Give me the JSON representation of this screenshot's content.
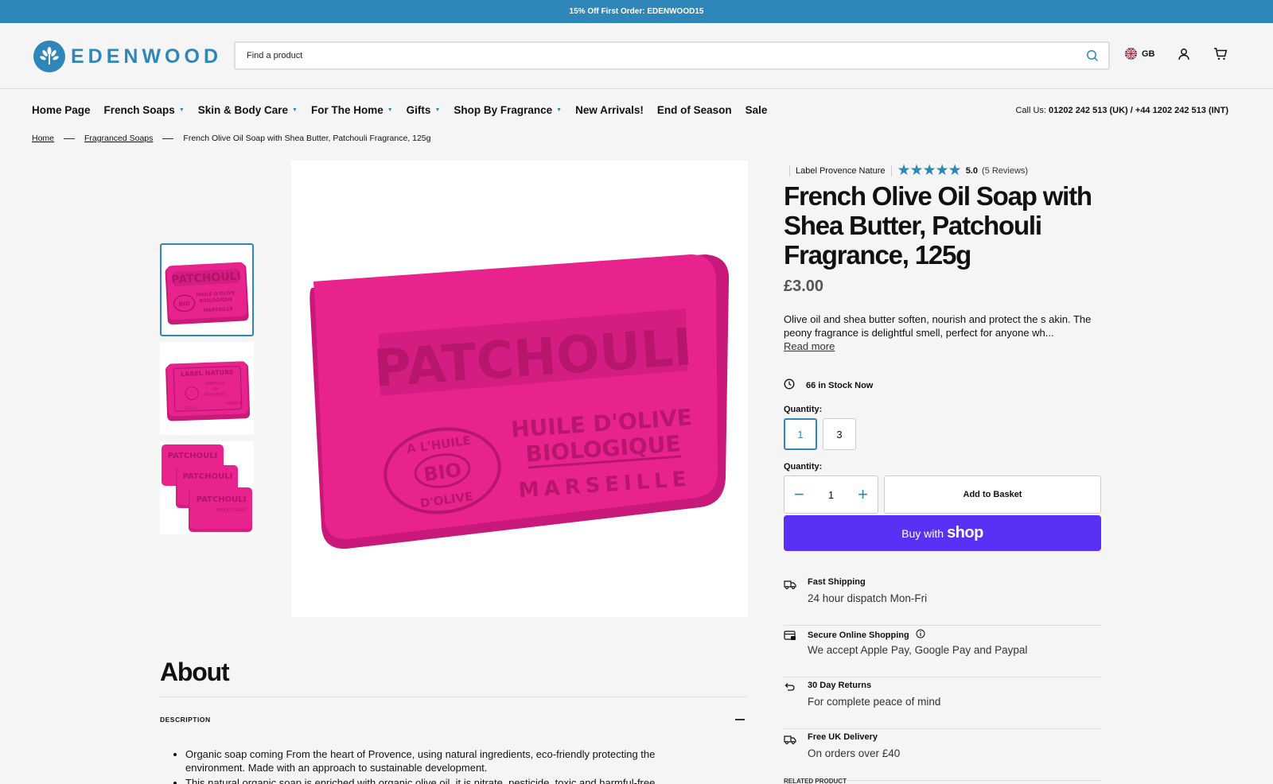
{
  "promo": {
    "text": "15% Off First Order: EDENWOOD15"
  },
  "header": {
    "logo_text": "EDENWOOD",
    "search_placeholder": "Find a product",
    "country": "GB"
  },
  "nav": {
    "items": [
      {
        "label": "Home Page",
        "caret": false
      },
      {
        "label": "French Soaps",
        "caret": true
      },
      {
        "label": "Skin & Body Care",
        "caret": true
      },
      {
        "label": "For The Home",
        "caret": true
      },
      {
        "label": "Gifts",
        "caret": true
      },
      {
        "label": "Shop By Fragrance",
        "caret": true
      },
      {
        "label": "New Arrivals!",
        "caret": false
      },
      {
        "label": "End of Season",
        "caret": false
      },
      {
        "label": "Sale",
        "caret": false
      }
    ],
    "call_label": "Call Us:",
    "call_numbers": "01202 242 513 (UK) / +44 1202 242 513 (INT)"
  },
  "breadcrumb": {
    "home": "Home",
    "category": "Fragranced Soaps",
    "current": "French Olive Oil Soap with Shea Butter, Patchouli Fragrance, 125g"
  },
  "product": {
    "vendor": "Label Provence Nature",
    "stars": "★★★★★",
    "rating": "5.0",
    "reviews": "(5 Reviews)",
    "title": "French Olive Oil Soap with Shea Butter, Patchouli Fragrance, 125g",
    "price": "£3.00",
    "description": "Olive oil and shea butter soften, nourish and protect the s akin. The peony fragrance is delightful smell, perfect for anyone wh...",
    "read_more": "Read more",
    "stock": "66 in Stock Now",
    "quantity_label": "Quantity:",
    "quantity_options": [
      "1",
      "3"
    ],
    "quantity_value": "1",
    "add_to_basket": "Add to Basket",
    "buy_with": "Buy with",
    "shop_word": "shop"
  },
  "soap": {
    "color": "#e8238e",
    "main_word": "PATCHOULI",
    "line1": "HUILE D'OLIVE",
    "line2": "BIOLOGIQUE",
    "line3": "MARSEILLE",
    "seal_top": "A L'HUILE",
    "seal_mid": "BIO",
    "seal_bottom": "D'OLIVE",
    "alt_label": "LABEL NATURE",
    "alt_sub1": "FABRIQUE",
    "alt_sub2": "EN",
    "alt_sub3": "PROVENCE",
    "alt_weight": "125 G",
    "alt_country": "FRANCE"
  },
  "features": [
    {
      "icon": "truck-icon",
      "title": "Fast Shipping",
      "sub": "24 hour dispatch Mon-Fri",
      "info": false
    },
    {
      "icon": "card-icon",
      "title": "Secure Online Shopping",
      "sub": "We accept Apple Pay, Google Pay and Paypal",
      "info": true
    },
    {
      "icon": "return-icon",
      "title": "30 Day Returns",
      "sub": "For complete peace of mind",
      "info": false
    },
    {
      "icon": "truck-icon",
      "title": "Free UK Delivery",
      "sub": "On orders over £40",
      "info": false
    }
  ],
  "related": "RELATED PRODUCT",
  "about": {
    "title": "About",
    "section": "DESCRIPTION",
    "bullets": [
      "Organic soap coming From the heart of Provence, using natural ingredients, eco-friendly protecting the environment. Made with an approach to sustainable development.",
      "This natural organic soap is enriched with organic olive oil, it is nitrate, pesticide, toxic and harmful-free."
    ]
  },
  "colors": {
    "brand": "#2f86b8",
    "shop": "#5a31f4",
    "soap": "#e8238e"
  }
}
